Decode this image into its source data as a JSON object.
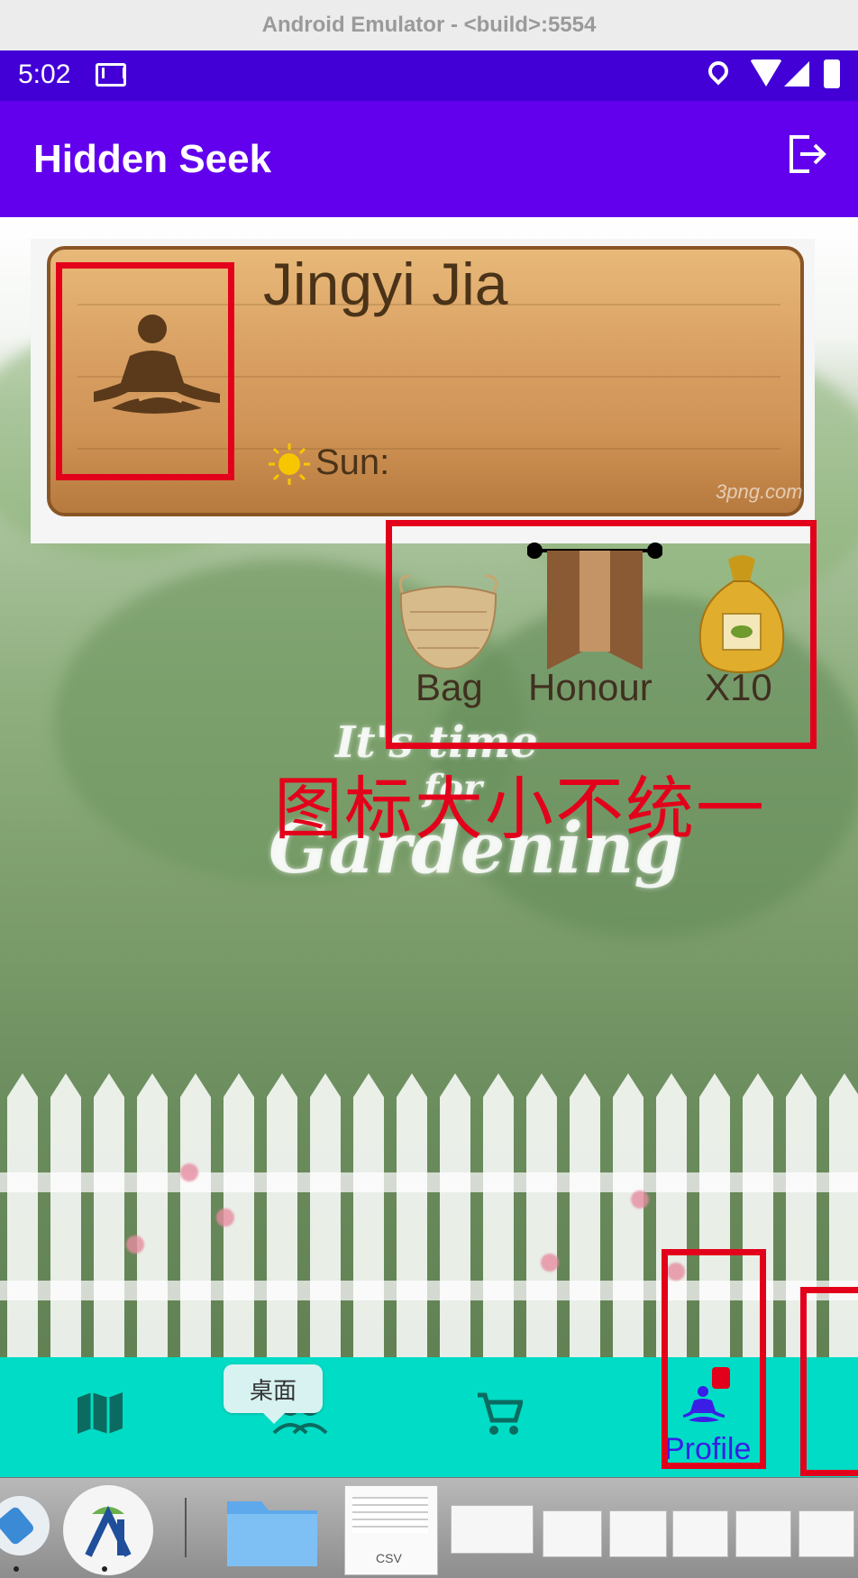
{
  "window": {
    "title": "Android Emulator - <build>:5554"
  },
  "status_bar": {
    "time": "5:02",
    "icons": [
      "gmail-icon",
      "location-icon",
      "wifi-icon",
      "signal-icon",
      "battery-icon"
    ]
  },
  "app_bar": {
    "title": "Hidden Seek",
    "action_icon": "logout-icon"
  },
  "profile": {
    "name": "Jingyi Jia",
    "sun_label": "Sun:",
    "avatar_icon": "meditation-icon",
    "watermark": "3png.com"
  },
  "items": [
    {
      "label": "Bag",
      "icon": "basket-icon"
    },
    {
      "label": "Honour",
      "icon": "banner-icon"
    },
    {
      "label": "X10",
      "icon": "seed-bag-icon"
    }
  ],
  "background_text": {
    "line1": "It's time",
    "line2": "for",
    "line3": "Gardening"
  },
  "annotation": {
    "text": "图标大小不统一",
    "color": "#e3001b"
  },
  "bottom_nav": {
    "items": [
      {
        "label": "",
        "icon": "map-icon"
      },
      {
        "label": "",
        "icon": "friends-icon"
      },
      {
        "label": "",
        "icon": "cart-icon"
      },
      {
        "label": "Profile",
        "icon": "meditation-icon",
        "selected": true
      }
    ],
    "tooltip": "桌面",
    "background": "#00dcc5",
    "selected_color": "#3a1ee6"
  },
  "dock": {
    "items": [
      "screen-rotation-app-icon",
      "android-studio-icon",
      "folder-icon",
      "csv-file-icon",
      "window-thumbnails"
    ],
    "csv_label": "CSV"
  },
  "colors": {
    "status_bar": "#4200d6",
    "app_bar": "#6200ee",
    "highlight_red": "#e3001b"
  }
}
